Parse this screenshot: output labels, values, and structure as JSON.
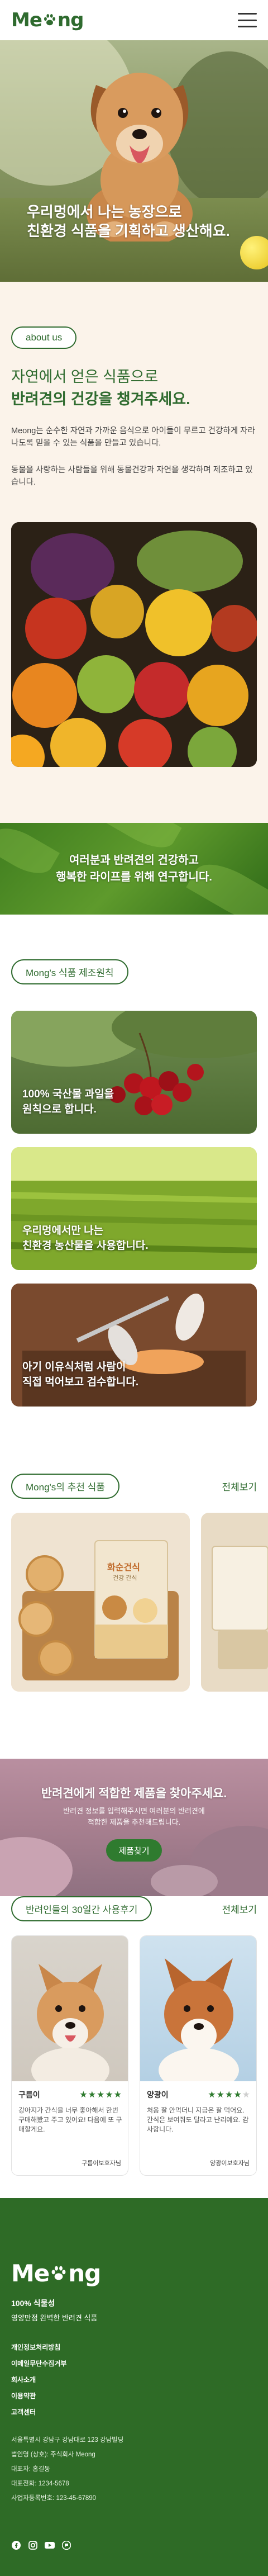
{
  "header": {
    "logo_text_left": "Me",
    "logo_text_right": "ng"
  },
  "hero": {
    "line1": "우리멍에서 나는 농장으로",
    "line2": "친환경 식품을 기획하고 생산해요."
  },
  "about": {
    "badge": "about us",
    "title_line1": "자연에서 얻은 식품으로",
    "title_line2": "반려견의 건강을 챙겨주세요.",
    "para1": "Meong는 순수한 자연과 가까운 음식으로 아이들이 무르고 건강하게 자라나도록 믿을 수 있는 식품을 만들고 있습니다.",
    "para2": "동물을 사랑하는 사람들을 위해 동물건강과 자연을 생각하며 제조하고 있습니다."
  },
  "banner": {
    "line1": "여러분과 반려견의 건강하고",
    "line2": "행복한 라이프를 위해 연구합니다."
  },
  "principles": {
    "badge": "Mong's 식품 제조원칙",
    "cards": [
      {
        "line1": "100% 국산물 과일을",
        "line2": "원칙으로 합니다."
      },
      {
        "line1": "우리멍에서만 나는",
        "line2": "친환경 농산물을 사용합니다."
      },
      {
        "line1": "아기 이유식처럼 사람이",
        "line2": "직접 먹어보고 검수합니다."
      }
    ]
  },
  "recommend": {
    "badge": "Mong's의 추천 식품",
    "see_all": "전체보기",
    "product_label": "화순건식",
    "product_sub": "건강 간식"
  },
  "find": {
    "title": "반려견에게 적합한 제품을 찾아주세요.",
    "sub1": "반려견 정보를 입력해주시면 여러분의 반려견에",
    "sub2": "적합한 제품을 추천해드립니다.",
    "button": "제품찾기"
  },
  "reviews": {
    "badge": "반려인들의 30일간 사용후기",
    "see_all": "전체보기",
    "items": [
      {
        "name": "구름이",
        "stars": 5,
        "text": "강아지가 간식을 너무 좋아해서 한번 구매해봤고 주고 있어요! 다음에 또 구매할게요.",
        "meta": "구름이보호자님"
      },
      {
        "name": "양광이",
        "stars": 4,
        "text": "처음 잘 안먹더니 지금은 잘 먹어요. 간식은 보여줘도 달라고 난리예요. 감사합니다.",
        "meta": "양광이보호자님"
      }
    ]
  },
  "footer": {
    "logo_left": "Me",
    "logo_right": "ng",
    "tag1": "100% 식물성",
    "tag2": "영양만점 완벽한 반려견 식품",
    "links": [
      "개인정보처리방침",
      "이메일무단수집거부",
      "회사소개",
      "이용약관",
      "고객센터"
    ],
    "info": [
      "서울특별시 강남구 강남대로 123 강남빌딩",
      "법인명 (상호): 주식회사 Meong",
      "대표자: 홍길동",
      "대표전화: 1234-5678",
      "사업자등록번호: 123-45-67890"
    ]
  },
  "colors": {
    "brand_green": "#2f6b2f",
    "footer_green": "#2e6b26",
    "cream": "#fbf3ea"
  }
}
